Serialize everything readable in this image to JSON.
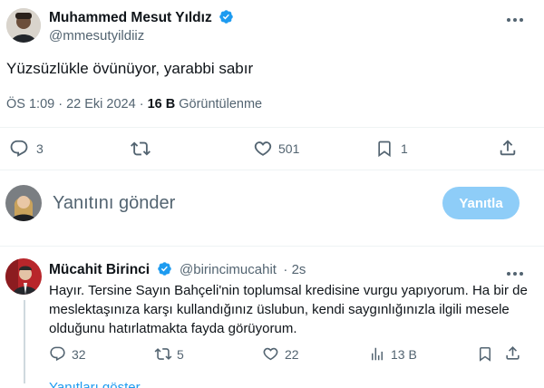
{
  "main_tweet": {
    "author_name": "Muhammed Mesut Yıldız",
    "handle": "@mmesutyildiiz",
    "text": "Yüzsüzlükle övünüyor, yarabbi sabır",
    "time": "ÖS 1:09 · 22 Eki 2024 · ",
    "views_count": "16 B",
    "views_label": " Görüntülenme",
    "replies": "3",
    "retweets": "",
    "likes": "501",
    "bookmarks": "1"
  },
  "compose": {
    "placeholder": "Yanıtını gönder",
    "reply_button": "Yanıtla"
  },
  "reply_tweet": {
    "author_name": "Mücahit Birinci",
    "handle": "@birincimucahit",
    "age": "· 2s",
    "text": "Hayır. Tersine Sayın Bahçeli'nin toplumsal kredisine vurgu yapıyorum. Ha bir de meslektaşınıza karşı kullandığınız üslubun, kendi saygınlığınızla ilgili mesele olduğunu hatırlatmakta fayda görüyorum.",
    "replies": "32",
    "retweets": "5",
    "likes": "22",
    "views": "13 B"
  },
  "more_link": "Yanıtları göster",
  "colors": {
    "accent": "#1d9bf0",
    "button_disabled": "#8ecdf8",
    "muted": "#536471",
    "text": "#0f1419"
  }
}
